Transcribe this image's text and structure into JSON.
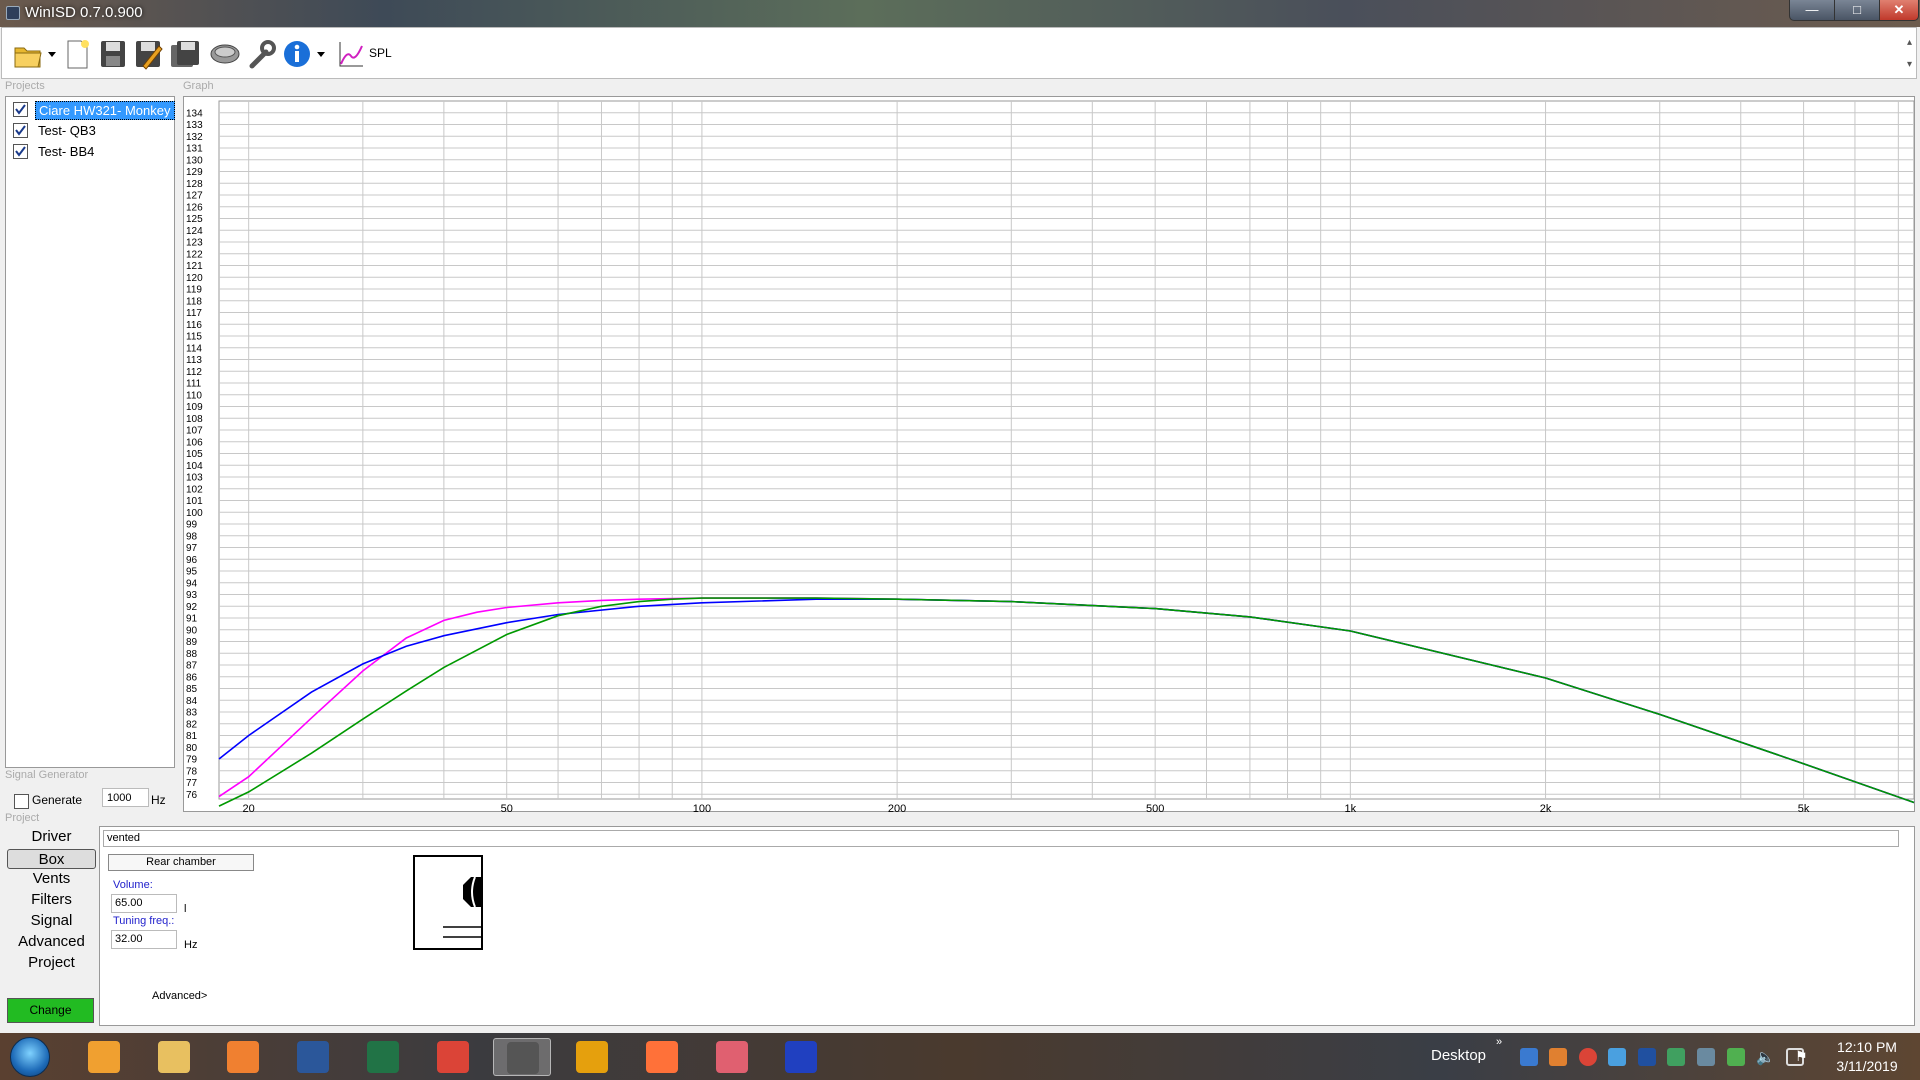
{
  "window": {
    "title": "WinISD 0.7.0.900"
  },
  "toolbar": {
    "spl_label": "SPL"
  },
  "sections": {
    "projects": "Projects",
    "graph": "Graph",
    "signal_generator": "Signal Generator",
    "project": "Project"
  },
  "projects": [
    {
      "name": "Ciare HW321- Monkey",
      "checked": true,
      "selected": true
    },
    {
      "name": "Test- QB3",
      "checked": true,
      "selected": false
    },
    {
      "name": "Test- BB4",
      "checked": true,
      "selected": false
    }
  ],
  "signal_generator": {
    "generate_label": "Generate",
    "frequency": "1000",
    "unit": "Hz"
  },
  "chart_data": {
    "type": "line",
    "x_scale": "log",
    "xlim": [
      18,
      7400
    ],
    "ylim": [
      75.6,
      135
    ],
    "y_ticks": [
      76,
      77,
      78,
      79,
      80,
      81,
      82,
      83,
      84,
      85,
      86,
      87,
      88,
      89,
      90,
      91,
      92,
      93,
      94,
      95,
      96,
      97,
      98,
      99,
      100,
      101,
      102,
      103,
      104,
      105,
      106,
      107,
      108,
      109,
      110,
      111,
      112,
      113,
      114,
      115,
      116,
      117,
      118,
      119,
      120,
      121,
      122,
      123,
      124,
      125,
      126,
      127,
      128,
      129,
      130,
      131,
      132,
      133,
      134
    ],
    "x_tick_labels": [
      {
        "x": 20,
        "label": "20"
      },
      {
        "x": 50,
        "label": "50"
      },
      {
        "x": 100,
        "label": "100"
      },
      {
        "x": 200,
        "label": "200"
      },
      {
        "x": 500,
        "label": "500"
      },
      {
        "x": 1000,
        "label": "1k"
      },
      {
        "x": 2000,
        "label": "2k"
      },
      {
        "x": 5000,
        "label": "5k"
      }
    ],
    "grid": true,
    "series": [
      {
        "color": "#ff00ff",
        "x": [
          18,
          20,
          25,
          30,
          35,
          40,
          45,
          50,
          60,
          70,
          80,
          100,
          150,
          200,
          300,
          500,
          700,
          1000,
          2000,
          3000,
          5000,
          7400
        ],
        "y": [
          75.8,
          77.5,
          82.5,
          86.5,
          89.3,
          90.8,
          91.5,
          91.9,
          92.3,
          92.5,
          92.6,
          92.7,
          92.7,
          92.6,
          92.4,
          91.8,
          91.1,
          89.9,
          85.9,
          82.8,
          78.6,
          75.3
        ]
      },
      {
        "color": "#0000ff",
        "x": [
          18,
          20,
          25,
          30,
          35,
          40,
          50,
          60,
          80,
          100,
          150,
          200,
          300,
          500,
          700,
          1000,
          2000,
          3000,
          5000,
          7400
        ],
        "y": [
          79.0,
          81.0,
          84.7,
          87.1,
          88.6,
          89.5,
          90.6,
          91.3,
          92.0,
          92.3,
          92.6,
          92.6,
          92.4,
          91.8,
          91.1,
          89.9,
          85.9,
          82.8,
          78.6,
          75.3
        ]
      },
      {
        "color": "#009900",
        "x": [
          18,
          20,
          25,
          30,
          35,
          40,
          50,
          60,
          70,
          80,
          90,
          100,
          150,
          200,
          300,
          500,
          700,
          1000,
          2000,
          3000,
          5000,
          7400
        ],
        "y": [
          75.0,
          76.2,
          79.5,
          82.4,
          84.8,
          86.8,
          89.6,
          91.2,
          92.0,
          92.4,
          92.6,
          92.7,
          92.7,
          92.6,
          92.4,
          91.8,
          91.1,
          89.9,
          85.9,
          82.8,
          78.6,
          75.3
        ]
      }
    ]
  },
  "project_tabs": [
    {
      "label": "Driver",
      "active": false
    },
    {
      "label": "Box",
      "active": true
    },
    {
      "label": "Vents",
      "active": false
    },
    {
      "label": "Filters",
      "active": false
    },
    {
      "label": "Signal",
      "active": false
    },
    {
      "label": "Advanced",
      "active": false
    },
    {
      "label": "Project",
      "active": false
    }
  ],
  "change_label": "Change",
  "box": {
    "type": "vented",
    "rear_chamber": "Rear chamber",
    "volume_label": "Volume:",
    "volume": "65.00",
    "volume_unit": "l",
    "tuning_label": "Tuning freq.:",
    "tuning": "32.00",
    "tuning_unit": "Hz",
    "advanced": "Advanced>"
  },
  "taskbar": {
    "apps": [
      {
        "name": "outlook-icon",
        "color": "#f0a030"
      },
      {
        "name": "explorer-icon",
        "color": "#e8c060"
      },
      {
        "name": "media-player-icon",
        "color": "#f08030"
      },
      {
        "name": "word-icon",
        "color": "#2b579a"
      },
      {
        "name": "excel-icon",
        "color": "#217346"
      },
      {
        "name": "chrome-icon",
        "color": "#db4437"
      },
      {
        "name": "winisd-icon",
        "color": "#555555",
        "active": true
      },
      {
        "name": "plex-icon",
        "color": "#e5a00d"
      },
      {
        "name": "firefox-icon",
        "color": "#ff7139"
      },
      {
        "name": "snipping-tool-icon",
        "color": "#e06070"
      },
      {
        "name": "app-icon",
        "color": "#2040c0"
      }
    ],
    "desktop": "Desktop",
    "time": "12:10 PM",
    "date": "3/11/2019"
  }
}
